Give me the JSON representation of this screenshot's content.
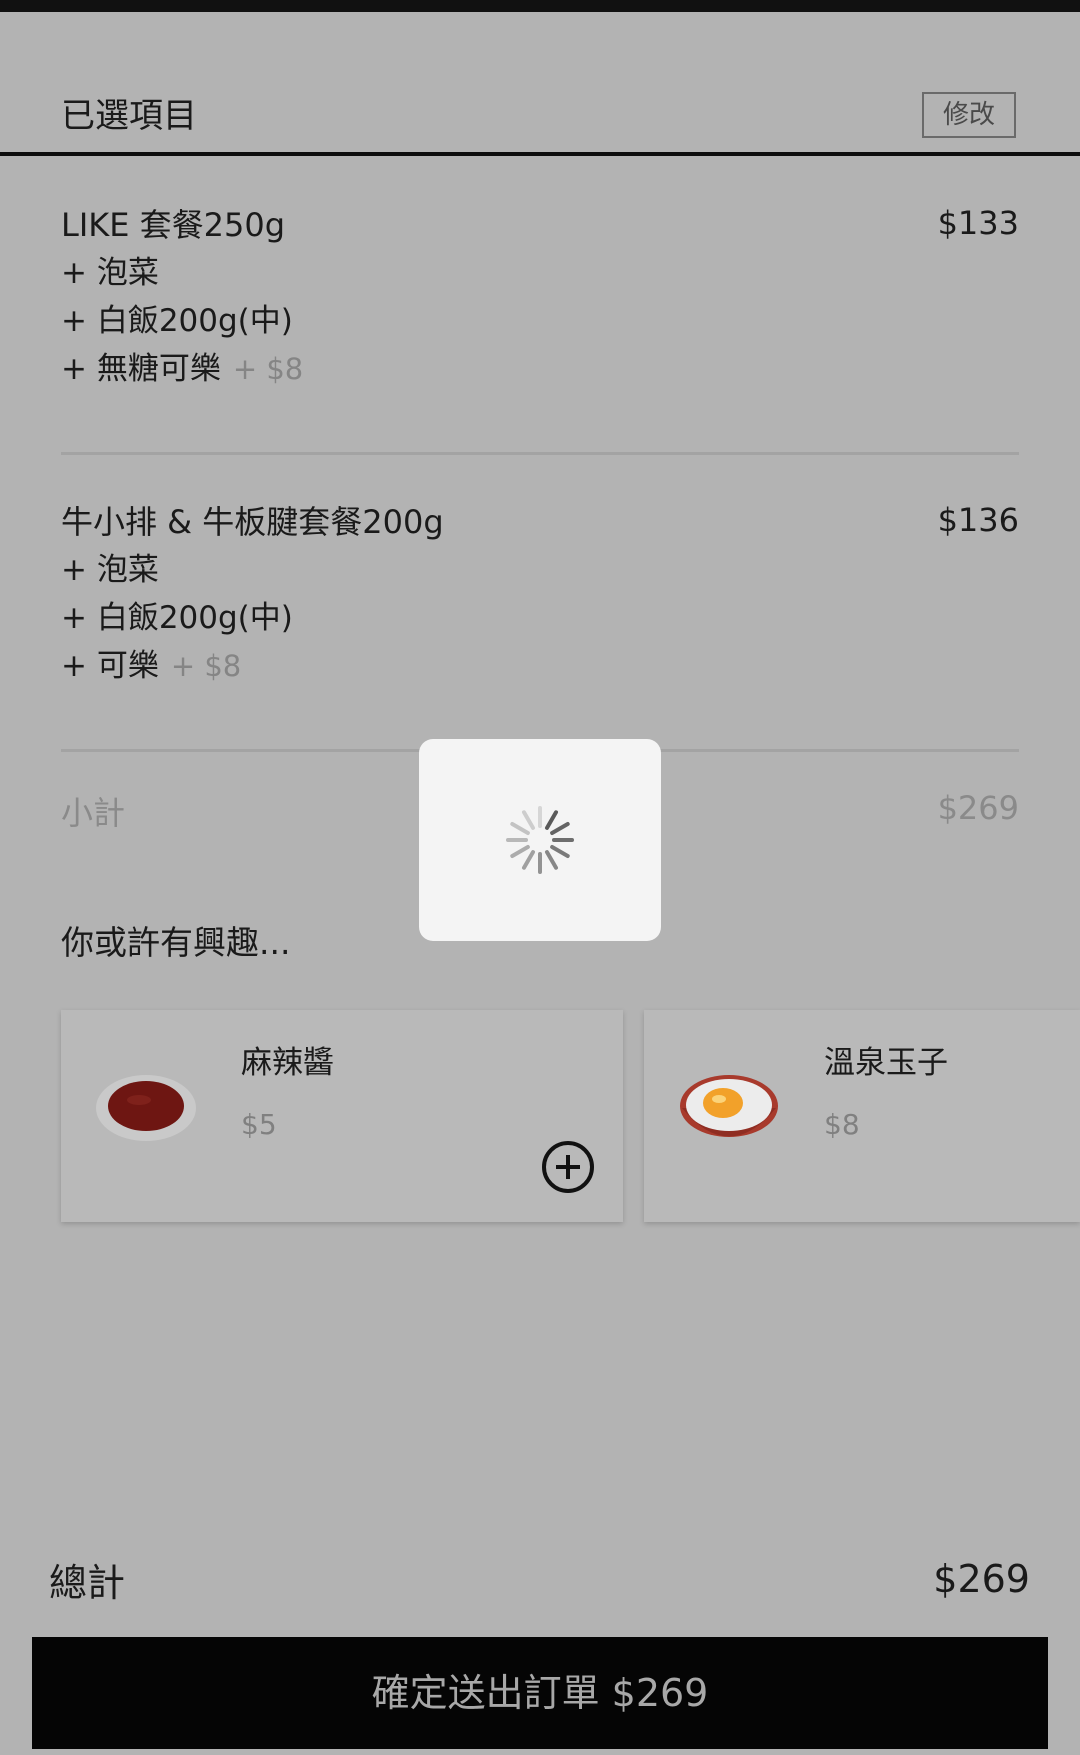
{
  "section": {
    "title": "已選項目",
    "edit_label": "修改"
  },
  "order_items": [
    {
      "name": "LIKE 套餐250g",
      "price": "$133",
      "options": [
        {
          "label": "+ 泡菜",
          "extra": ""
        },
        {
          "label": "+ 白飯200g(中)",
          "extra": ""
        },
        {
          "label": "+ 無糖可樂",
          "extra": "+ $8"
        }
      ]
    },
    {
      "name": "牛小排 & 牛板腱套餐200g",
      "price": "$136",
      "options": [
        {
          "label": "+ 泡菜",
          "extra": ""
        },
        {
          "label": "+ 白飯200g(中)",
          "extra": ""
        },
        {
          "label": "+ 可樂",
          "extra": "+ $8"
        }
      ]
    }
  ],
  "subtotal": {
    "label": "小計",
    "value": "$269"
  },
  "recommendations": {
    "title": "你或許有興趣...",
    "items": [
      {
        "name": "麻辣醬",
        "price": "$5"
      },
      {
        "name": "溫泉玉子",
        "price": "$8"
      }
    ]
  },
  "total": {
    "label": "總計",
    "value": "$269"
  },
  "submit": {
    "label": "確定送出訂單",
    "amount": "$269"
  },
  "colors": {
    "overlay": "#b3b3b3",
    "button": "#050505",
    "loader_bg": "#f4f4f4"
  }
}
